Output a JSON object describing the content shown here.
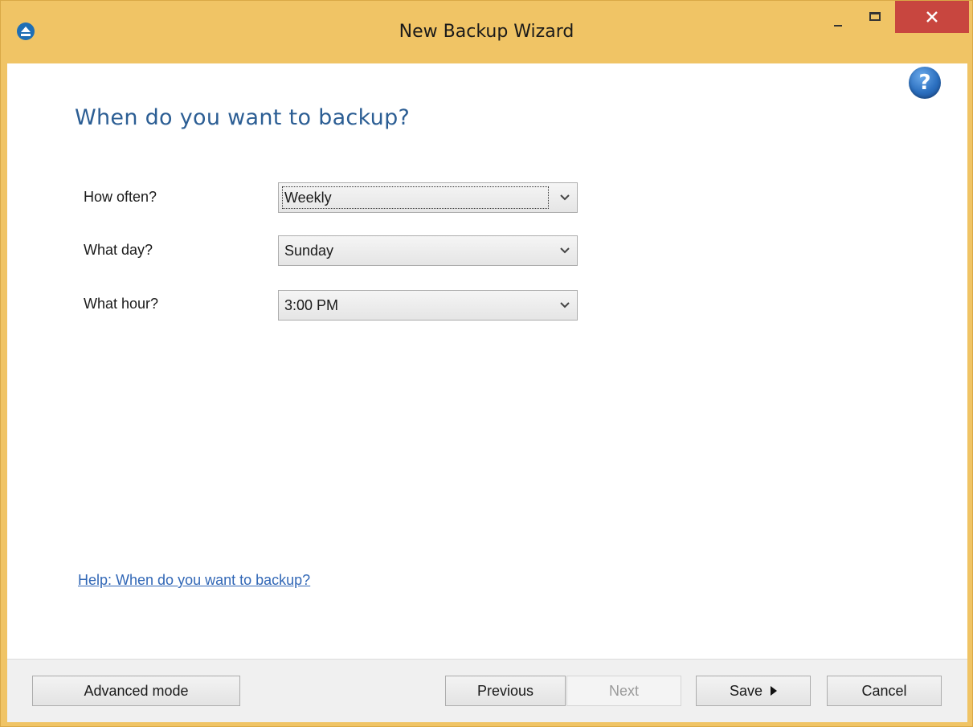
{
  "window": {
    "title": "New Backup Wizard",
    "controls": {
      "minimize": "minimize",
      "maximize": "maximize",
      "close": "close"
    },
    "accent_color": "#f0c465",
    "close_color": "#c8463f"
  },
  "main": {
    "help_icon_glyph": "?",
    "heading": "When do you want to backup?",
    "fields": [
      {
        "label": "How often?",
        "value": "Weekly"
      },
      {
        "label": "What day?",
        "value": "Sunday"
      },
      {
        "label": "What hour?",
        "value": "3:00 PM"
      }
    ],
    "help_link": "Help: When do you want to backup?"
  },
  "footer": {
    "advanced_mode": "Advanced mode",
    "previous": "Previous",
    "next": "Next",
    "save": "Save",
    "cancel": "Cancel"
  },
  "icons": [
    "app-eject-icon",
    "help-icon",
    "chevron-down-icon",
    "close-icon",
    "play-arrow-icon"
  ]
}
